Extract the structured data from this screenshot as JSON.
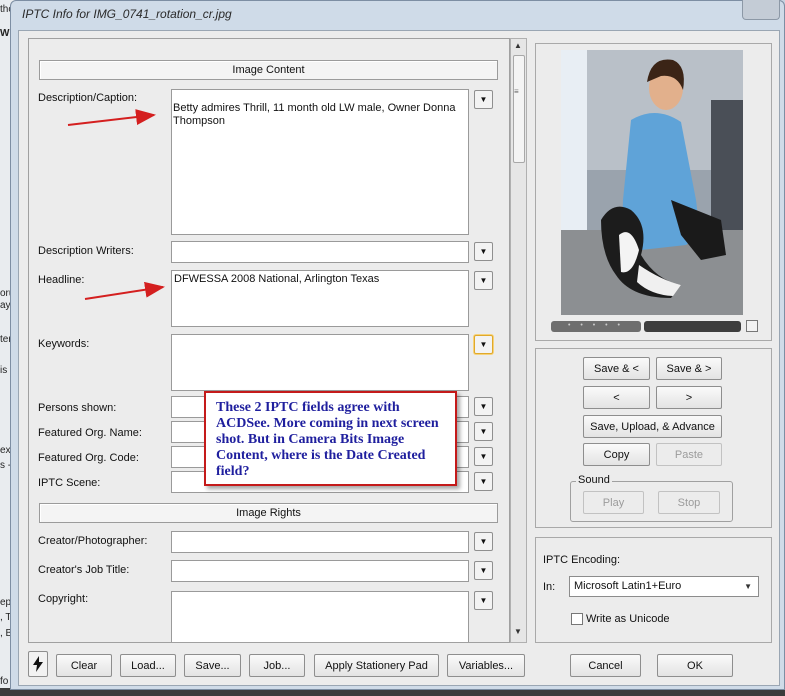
{
  "window": {
    "title": "IPTC Info for IMG_0741_rotation_cr.jpg"
  },
  "background_left": {
    "fragments": [
      "tho",
      "W",
      "orur",
      "ayo",
      "ters",
      "is",
      "ex w",
      "s - D",
      "epa",
      ", T",
      ", Be",
      "fo"
    ]
  },
  "content_section": {
    "header": "Image Content"
  },
  "rights_section": {
    "header": "Image Rights"
  },
  "fields": {
    "description": {
      "label": "Description/Caption:",
      "value": "Betty admires Thrill, 11 month old LW male, Owner Donna Thompson"
    },
    "description_writers": {
      "label": "Description Writers:",
      "value": ""
    },
    "headline": {
      "label": "Headline:",
      "value": "DFWESSA 2008 National, Arlington Texas"
    },
    "keywords": {
      "label": "Keywords:",
      "value": ""
    },
    "persons_shown": {
      "label": "Persons shown:",
      "value": ""
    },
    "featured_org_name": {
      "label": "Featured Org. Name:",
      "value": ""
    },
    "featured_org_code": {
      "label": "Featured Org. Code:",
      "value": ""
    },
    "iptc_scene": {
      "label": "IPTC Scene:",
      "value": ""
    },
    "creator": {
      "label": "Creator/Photographer:",
      "value": ""
    },
    "creator_job_title": {
      "label": "Creator's Job Title:",
      "value": ""
    },
    "copyright": {
      "label": "Copyright:",
      "value": ""
    }
  },
  "annotation": {
    "text": "These 2 IPTC fields agree with ACDSee. More coming in next screen shot. But in Camera Bits Image Content, where is the Date Created field?"
  },
  "nav_buttons": {
    "save_prev": "Save & <",
    "save_next": "Save & >",
    "prev": "<",
    "next": ">",
    "save_upload_advance": "Save, Upload, & Advance",
    "copy": "Copy",
    "paste": "Paste"
  },
  "sound": {
    "label": "Sound",
    "play": "Play",
    "stop": "Stop"
  },
  "encoding": {
    "title": "IPTC Encoding:",
    "in_label": "In:",
    "selected": "Microsoft Latin1+Euro",
    "unicode_label": "Write as Unicode",
    "unicode_checked": false
  },
  "bottom_bar": {
    "clear": "Clear",
    "load": "Load...",
    "save": "Save...",
    "job": "Job...",
    "apply_stationery": "Apply Stationery Pad",
    "variables": "Variables...",
    "cancel": "Cancel",
    "ok": "OK"
  },
  "colors": {
    "annotation_border": "#c41a1a",
    "annotation_text": "#1f1f9e",
    "arrow": "#d41f1f"
  }
}
